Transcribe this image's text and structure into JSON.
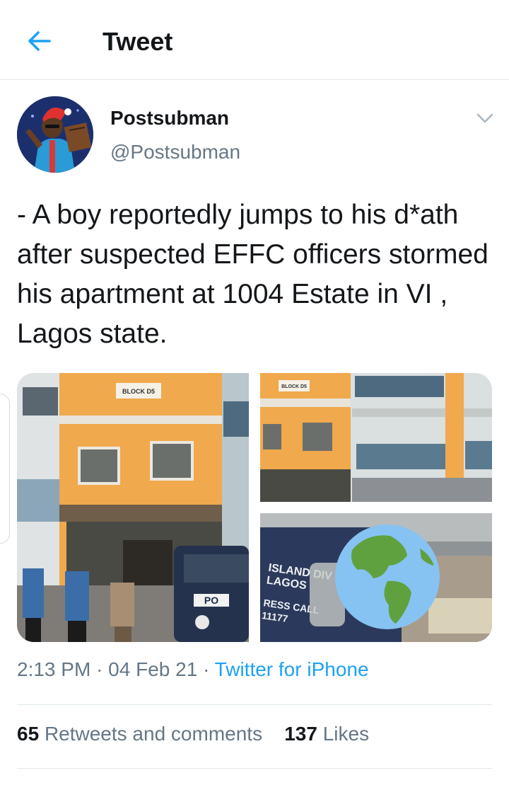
{
  "header": {
    "title": "Tweet",
    "back_icon": "arrow-left-icon",
    "accent": "#1da1f2"
  },
  "tweet": {
    "display_name": "Postsubman",
    "handle": "@Postsubman",
    "menu_icon": "chevron-down-icon",
    "text": "- A boy reportedly jumps to his d*ath after suspected EFFC officers stormed his apartment at 1004 Estate in VI , Lagos state.",
    "media": {
      "photo_1": {
        "sign": "BLOCK D5",
        "car_text": "PO"
      },
      "photo_2": {
        "sign": "BLOCK D5"
      },
      "photo_3": {
        "car_text_1": "ISLAND DIV",
        "car_text_2": "LAGOS",
        "car_text_3": "RESS CALL",
        "car_text_4": "11177",
        "overlay_icon": "globe-icon"
      }
    },
    "time": "2:13 PM",
    "date": "04 Feb 21",
    "separator": "·",
    "source": "Twitter for iPhone"
  },
  "stats": {
    "retweets_count": "65",
    "retweets_label": "Retweets and comments",
    "likes_count": "137",
    "likes_label": "Likes"
  }
}
